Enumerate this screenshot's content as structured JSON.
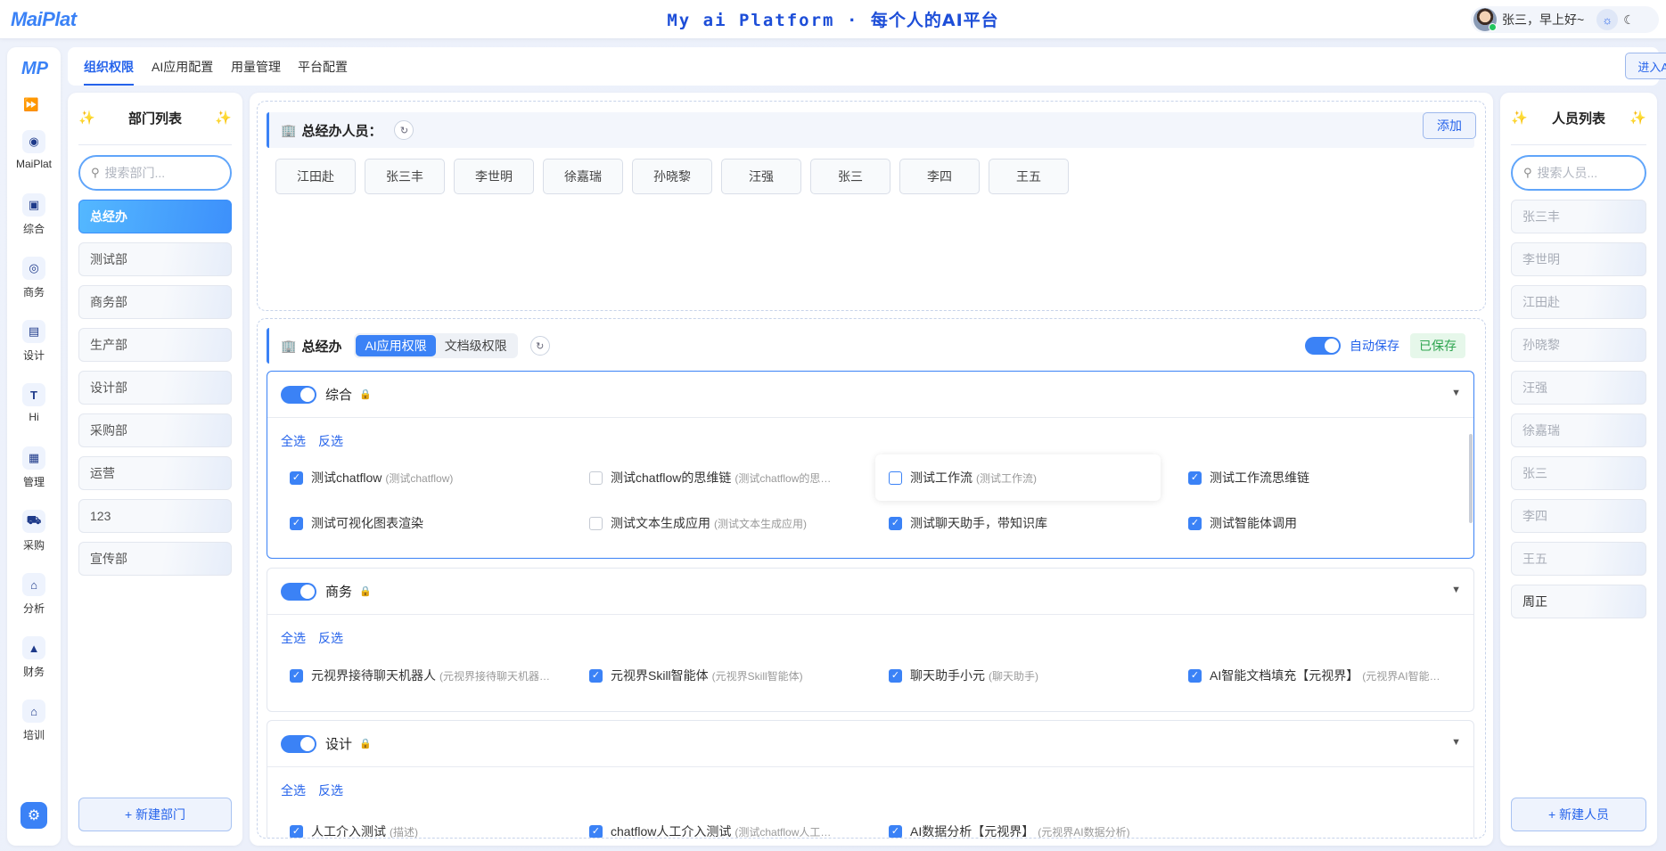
{
  "app": {
    "logo": "MaiPlat",
    "headline_en": "My ai Platform",
    "headline_sep": "·",
    "headline_cn": "每个人的AI平台",
    "greeting": "张三，早上好~",
    "theme_light_icon": "☼",
    "theme_dark_icon": "☾"
  },
  "sidebar": {
    "logo": "MP",
    "collapse_icon": "⏩",
    "items": [
      {
        "label": "MaiPlat",
        "icon": "robot-icon",
        "glyph": "◉"
      },
      {
        "label": "综合",
        "icon": "save-icon",
        "glyph": "▣"
      },
      {
        "label": "商务",
        "icon": "headset-icon",
        "glyph": "◎"
      },
      {
        "label": "设计",
        "icon": "document-icon",
        "glyph": "▤"
      },
      {
        "label": "Hi",
        "icon": "text-icon",
        "glyph": "T"
      },
      {
        "label": "管理",
        "icon": "archive-icon",
        "glyph": "▦"
      },
      {
        "label": "采购",
        "icon": "cart-icon",
        "glyph": "⛟"
      },
      {
        "label": "分析",
        "icon": "home-icon",
        "glyph": "⌂"
      },
      {
        "label": "财务",
        "icon": "lock-icon",
        "glyph": "▲"
      },
      {
        "label": "培训",
        "icon": "home-icon",
        "glyph": "⌂"
      }
    ],
    "settings_icon": "⚙"
  },
  "tabs": [
    "组织权限",
    "AI应用配置",
    "用量管理",
    "平台配置"
  ],
  "enter_button": "进入AI工作室",
  "dept_panel": {
    "title": "部门列表",
    "spark": "✨",
    "search_placeholder": "搜索部门...",
    "items": [
      "总经办",
      "测试部",
      "商务部",
      "生产部",
      "设计部",
      "采购部",
      "运营",
      "123",
      "宣传部"
    ],
    "add_label": "+ 新建部门"
  },
  "members_card": {
    "title": "总经办人员：",
    "add_label": "添加",
    "members": [
      "江田赴",
      "张三丰",
      "李世明",
      "徐嘉瑞",
      "孙晓黎",
      "汪强",
      "张三",
      "李四",
      "王五"
    ]
  },
  "perm_card": {
    "dept": "总经办",
    "seg": [
      "AI应用权限",
      "文档级权限"
    ],
    "auto_save": "自动保存",
    "saved": "已保存",
    "select_all": "全选",
    "invert": "反选",
    "sections": [
      {
        "name": "综合",
        "options": [
          {
            "label": "测试chatflow",
            "sub": "(测试chatflow)",
            "checked": true
          },
          {
            "label": "测试chatflow的思维链",
            "sub": "(测试chatflow的思…",
            "checked": false
          },
          {
            "label": "测试工作流",
            "sub": "(测试工作流)",
            "checked": false
          },
          {
            "label": "测试工作流思维链",
            "sub": "",
            "checked": true
          },
          {
            "label": "测试可视化图表渲染",
            "sub": "",
            "checked": true
          },
          {
            "label": "测试文本生成应用",
            "sub": "(测试文本生成应用)",
            "checked": false
          },
          {
            "label": "测试聊天助手，带知识库",
            "sub": "",
            "checked": true
          },
          {
            "label": "测试智能体调用",
            "sub": "",
            "checked": true
          }
        ]
      },
      {
        "name": "商务",
        "options": [
          {
            "label": "元视界接待聊天机器人",
            "sub": "(元视界接待聊天机器…",
            "checked": true
          },
          {
            "label": "元视界Skill智能体",
            "sub": "(元视界Skill智能体)",
            "checked": true
          },
          {
            "label": "聊天助手小元",
            "sub": "(聊天助手)",
            "checked": true
          },
          {
            "label": "AI智能文档填充【元视界】",
            "sub": "(元视界AI智能…",
            "checked": true
          }
        ]
      },
      {
        "name": "设计",
        "options": [
          {
            "label": "人工介入测试",
            "sub": "(描述)",
            "checked": true
          },
          {
            "label": "chatflow人工介入测试",
            "sub": "(测试chatflow人工…",
            "checked": true
          },
          {
            "label": "AI数据分析【元视界】",
            "sub": "(元视界AI数据分析)",
            "checked": true
          }
        ]
      }
    ]
  },
  "people_panel": {
    "title": "人员列表",
    "search_placeholder": "搜索人员...",
    "items": [
      "张三丰",
      "李世明",
      "江田赴",
      "孙晓黎",
      "汪强",
      "徐嘉瑞",
      "张三",
      "李四",
      "王五",
      "周正"
    ],
    "add_label": "+ 新建人员"
  },
  "colors": {
    "accent": "#3b82f6",
    "spark": "#f5b400",
    "saved": "#2ea44f"
  }
}
